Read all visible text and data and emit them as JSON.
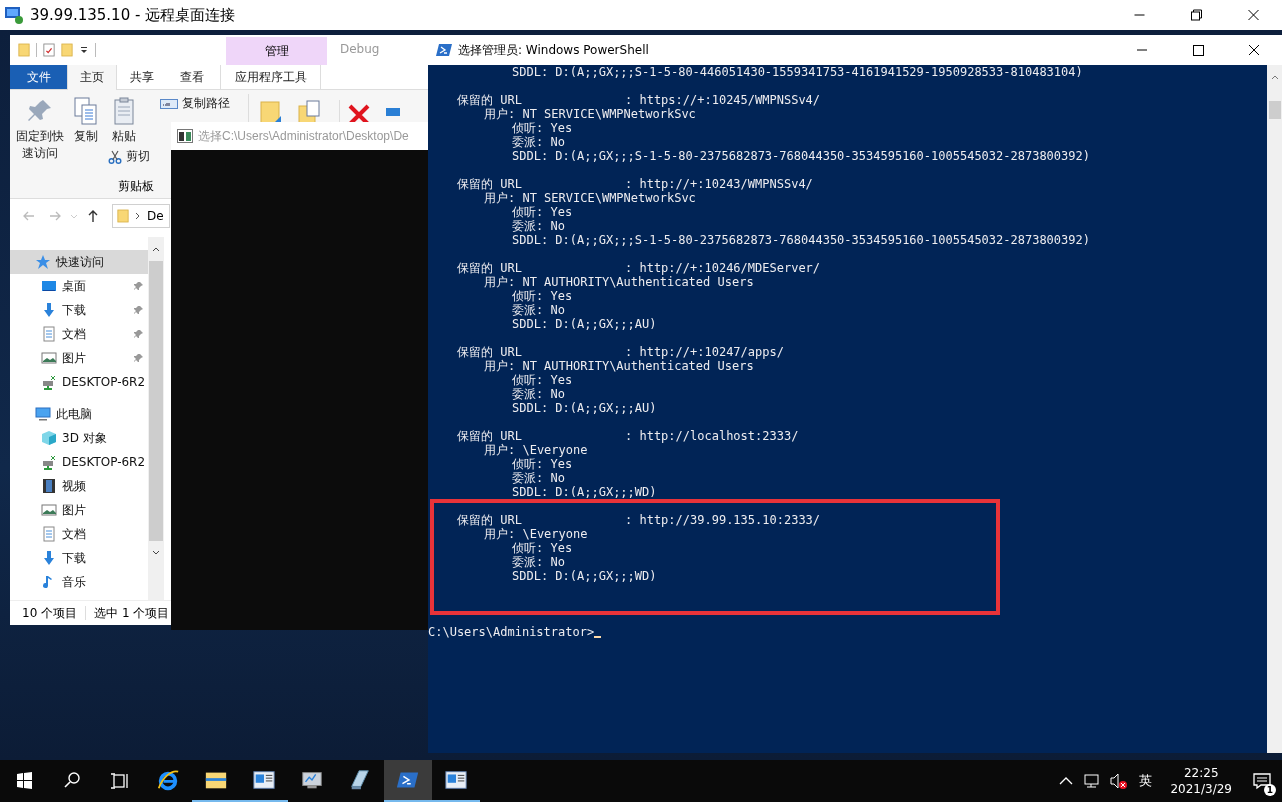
{
  "rdp": {
    "title": "39.99.135.10 - 远程桌面连接"
  },
  "explorer": {
    "context_group": "管理",
    "title": "Debug",
    "tabs": [
      {
        "label": "文件",
        "kind": "file",
        "selected": false
      },
      {
        "label": "主页",
        "kind": "tab",
        "selected": true
      },
      {
        "label": "共享",
        "kind": "tab",
        "selected": false
      },
      {
        "label": "查看",
        "kind": "tab",
        "selected": false
      },
      {
        "label": "应用程序工具",
        "kind": "context",
        "selected": false
      }
    ],
    "ribbon": {
      "pin_label": "固定到快速访问",
      "copy_label": "复制",
      "paste_label": "粘贴",
      "cut_label": "剪切",
      "copy_path_label": "复制路径",
      "group_label": "剪贴板"
    },
    "address": {
      "crumb": "De"
    },
    "sidebar": [
      {
        "label": "快速访问",
        "selected": true,
        "children": [
          {
            "label": "桌面",
            "pinned": true
          },
          {
            "label": "下载",
            "pinned": true
          },
          {
            "label": "文档",
            "pinned": true
          },
          {
            "label": "图片",
            "pinned": true
          },
          {
            "label": "DESKTOP-6R2",
            "pinned": false
          }
        ]
      },
      {
        "label": "此电脑",
        "selected": false,
        "children": [
          {
            "label": "3D 对象",
            "pinned": false
          },
          {
            "label": "DESKTOP-6R2",
            "pinned": false
          },
          {
            "label": "视频",
            "pinned": false
          },
          {
            "label": "图片",
            "pinned": false
          },
          {
            "label": "文档",
            "pinned": false
          },
          {
            "label": "下载",
            "pinned": false
          },
          {
            "label": "音乐",
            "pinned": false
          }
        ]
      }
    ],
    "status": {
      "count": "10 个项目",
      "selection": "选中 1 个项目"
    }
  },
  "console_window": {
    "title": "选择C:\\Users\\Administrator\\Desktop\\De"
  },
  "powershell": {
    "title": "选择管理员: Windows PowerShell",
    "lines": [
      {
        "kind": "detail",
        "text": "SDDL: D:(A;;GX;;;S-1-5-80-446051430-1559341753-4161941529-1950928533-810483104)"
      },
      {
        "kind": "blank"
      },
      {
        "kind": "url",
        "label": "保留的 URL",
        "value": ": https://+:10245/WMPNSSv4/"
      },
      {
        "kind": "user",
        "text": "用户: NT SERVICE\\WMPNetworkSvc"
      },
      {
        "kind": "detail",
        "text": "侦听: Yes"
      },
      {
        "kind": "detail",
        "text": "委派: No"
      },
      {
        "kind": "detail",
        "text": "SDDL: D:(A;;GX;;;S-1-5-80-2375682873-768044350-3534595160-1005545032-2873800392)"
      },
      {
        "kind": "blank"
      },
      {
        "kind": "url",
        "label": "保留的 URL",
        "value": ": http://+:10243/WMPNSSv4/"
      },
      {
        "kind": "user",
        "text": "用户: NT SERVICE\\WMPNetworkSvc"
      },
      {
        "kind": "detail",
        "text": "侦听: Yes"
      },
      {
        "kind": "detail",
        "text": "委派: No"
      },
      {
        "kind": "detail",
        "text": "SDDL: D:(A;;GX;;;S-1-5-80-2375682873-768044350-3534595160-1005545032-2873800392)"
      },
      {
        "kind": "blank"
      },
      {
        "kind": "url",
        "label": "保留的 URL",
        "value": ": http://+:10246/MDEServer/"
      },
      {
        "kind": "user",
        "text": "用户: NT AUTHORITY\\Authenticated Users"
      },
      {
        "kind": "detail",
        "text": "侦听: Yes"
      },
      {
        "kind": "detail",
        "text": "委派: No"
      },
      {
        "kind": "detail",
        "text": "SDDL: D:(A;;GX;;;AU)"
      },
      {
        "kind": "blank"
      },
      {
        "kind": "url",
        "label": "保留的 URL",
        "value": ": http://+:10247/apps/"
      },
      {
        "kind": "user",
        "text": "用户: NT AUTHORITY\\Authenticated Users"
      },
      {
        "kind": "detail",
        "text": "侦听: Yes"
      },
      {
        "kind": "detail",
        "text": "委派: No"
      },
      {
        "kind": "detail",
        "text": "SDDL: D:(A;;GX;;;AU)"
      },
      {
        "kind": "blank"
      },
      {
        "kind": "url",
        "label": "保留的 URL",
        "value": ": http://localhost:2333/"
      },
      {
        "kind": "user",
        "text": "用户: \\Everyone"
      },
      {
        "kind": "detail",
        "text": "侦听: Yes"
      },
      {
        "kind": "detail",
        "text": "委派: No"
      },
      {
        "kind": "detail",
        "text": "SDDL: D:(A;;GX;;;WD)"
      },
      {
        "kind": "blank"
      },
      {
        "kind": "url",
        "label": "保留的 URL",
        "value": ": http://39.99.135.10:2333/"
      },
      {
        "kind": "user",
        "text": "用户: \\Everyone"
      },
      {
        "kind": "detail",
        "text": "侦听: Yes"
      },
      {
        "kind": "detail",
        "text": "委派: No"
      },
      {
        "kind": "detail",
        "text": "SDDL: D:(A;;GX;;;WD)"
      },
      {
        "kind": "blank"
      },
      {
        "kind": "blank"
      },
      {
        "kind": "blank"
      },
      {
        "kind": "prompt",
        "text": "C:\\Users\\Administrator>",
        "cursor": true
      }
    ]
  },
  "taskbar": {
    "apps": [
      {
        "running": false,
        "active": false
      },
      {
        "running": true,
        "active": false
      },
      {
        "running": true,
        "active": false
      },
      {
        "running": false,
        "active": false
      },
      {
        "running": false,
        "active": false
      },
      {
        "running": true,
        "active": true
      },
      {
        "running": true,
        "active": false
      }
    ],
    "volume_muted": true,
    "ime": "英",
    "time": "22:25",
    "date": "2021/3/29",
    "notifications": "1"
  }
}
